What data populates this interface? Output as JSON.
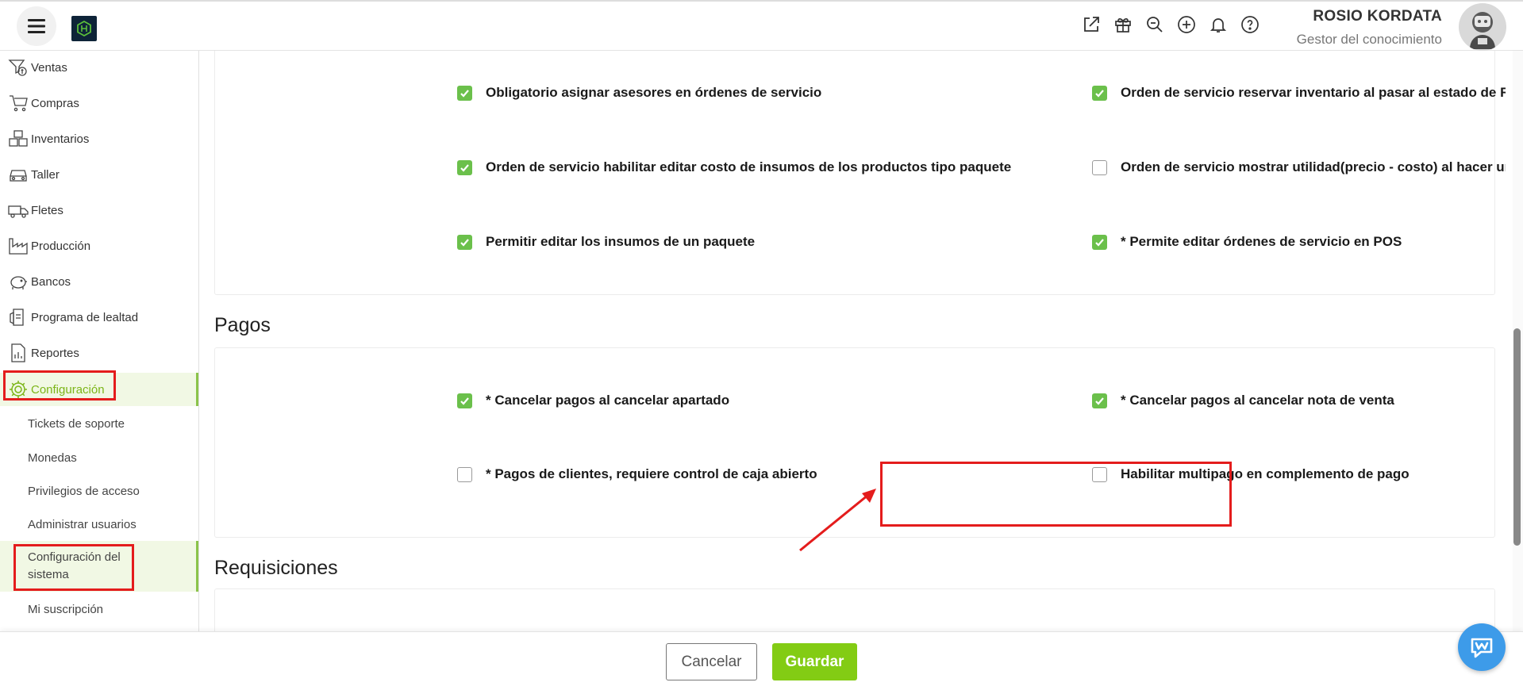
{
  "header": {
    "menu_icon": "hamburger-icon",
    "icons": [
      "external-link-icon",
      "gift-icon",
      "search-zoom-icon",
      "plus-circle-icon",
      "bell-icon",
      "help-icon"
    ],
    "user_name": "ROSIO KORDATA",
    "user_role": "Gestor del conocimiento"
  },
  "sidebar": {
    "items": [
      {
        "label": "Ventas",
        "icon": "sales-icon"
      },
      {
        "label": "Compras",
        "icon": "cart-icon"
      },
      {
        "label": "Inventarios",
        "icon": "boxes-icon"
      },
      {
        "label": "Taller",
        "icon": "car-icon"
      },
      {
        "label": "Fletes",
        "icon": "truck-icon"
      },
      {
        "label": "Producción",
        "icon": "factory-icon"
      },
      {
        "label": "Bancos",
        "icon": "piggy-bank-icon"
      },
      {
        "label": "Programa de lealtad",
        "icon": "loyalty-icon"
      },
      {
        "label": "Reportes",
        "icon": "report-icon"
      },
      {
        "label": "Configuración",
        "icon": "gear-icon"
      }
    ],
    "subitems": [
      {
        "label": "Tickets de soporte"
      },
      {
        "label": "Monedas"
      },
      {
        "label": "Privilegios de acceso"
      },
      {
        "label": "Administrar usuarios"
      },
      {
        "label": "Configuración del sistema"
      },
      {
        "label": "Mi suscripción"
      }
    ]
  },
  "sections": {
    "servicio": {
      "options": [
        {
          "label": "Obligatorio asignar asesores en órdenes de servicio",
          "checked": true
        },
        {
          "label": "Orden de servicio reservar inventario al pasar al estado de Reparación",
          "checked": true
        },
        {
          "label": "Orden de servicio habilitar editar costo de insumos de los productos tipo paquete",
          "checked": true
        },
        {
          "label": "Orden de servicio mostrar utilidad(precio - costo) al hacer un documento",
          "checked": false
        },
        {
          "label": "Permitir editar los insumos de un paquete",
          "checked": true
        },
        {
          "label": "* Permite editar órdenes de servicio en POS",
          "checked": true
        }
      ]
    },
    "pagos": {
      "title": "Pagos",
      "options": [
        {
          "label": "* Cancelar pagos al cancelar apartado",
          "checked": true
        },
        {
          "label": "* Cancelar pagos al cancelar nota de venta",
          "checked": true
        },
        {
          "label": "* Pagos de clientes, requiere control de caja abierto",
          "checked": false
        },
        {
          "label": "Habilitar multipago en complemento de pago",
          "checked": false
        }
      ]
    },
    "requisiciones": {
      "title": "Requisiciones"
    }
  },
  "footer": {
    "cancel_label": "Cancelar",
    "save_label": "Guardar"
  },
  "colors": {
    "accent": "#83cc14",
    "check": "#6bc04b",
    "highlight": "#e41c1c",
    "chat": "#3d9be9"
  }
}
